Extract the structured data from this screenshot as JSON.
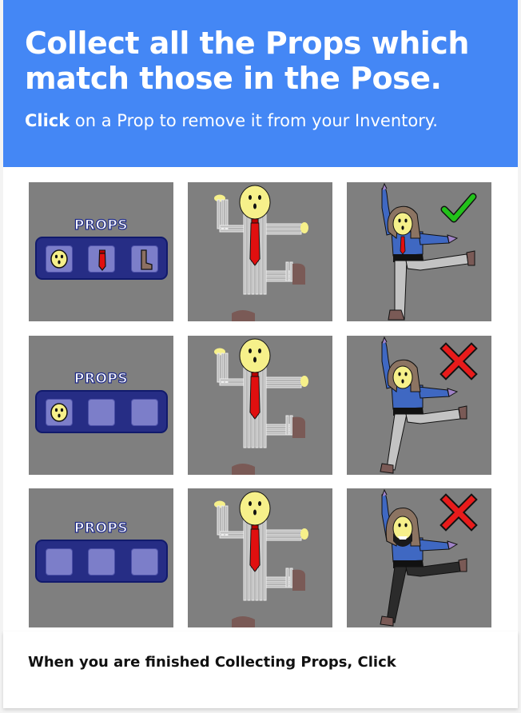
{
  "header": {
    "title": "Collect all the Props which match those in the Pose.",
    "instruction_bold": "Click",
    "instruction_rest": " on a Prop to remove it from your Inventory."
  },
  "rows": [
    {
      "props_label": "PROPS",
      "slots": [
        "face-mask",
        "red-tie",
        "boot"
      ],
      "result": "check"
    },
    {
      "props_label": "PROPS",
      "slots": [
        "face-mask",
        "empty",
        "empty"
      ],
      "result": "cross"
    },
    {
      "props_label": "PROPS",
      "slots": [
        "empty",
        "empty",
        "empty"
      ],
      "result": "cross"
    }
  ],
  "footer": {
    "message": "When you are finished Collecting Props, Click"
  },
  "colors": {
    "banner": "#4487f5",
    "panel": "#7f7f7f",
    "inventory": "#262d85",
    "slot": "#7c7ec9",
    "check": "#22c21a",
    "cross": "#e81b1b",
    "tie": "#e00f0f",
    "mask": "#f6f08a"
  }
}
